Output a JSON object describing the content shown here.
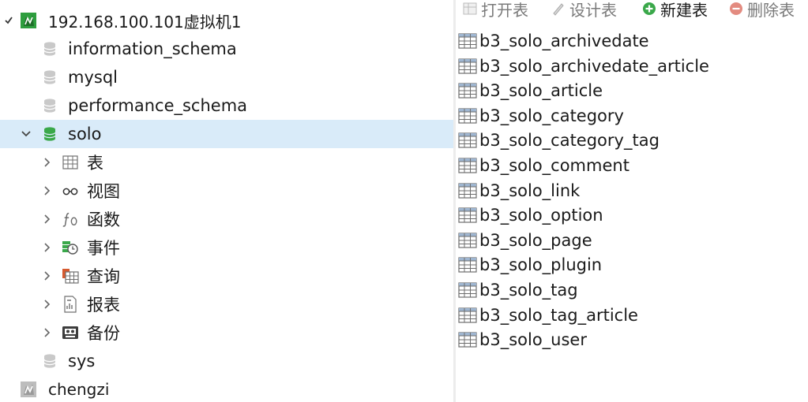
{
  "tree": {
    "connection": {
      "label": "192.168.100.101虚拟机1",
      "expanded": true,
      "icon": "connection-open-icon",
      "color": "#2e9e3e"
    },
    "databases": [
      {
        "label": "information_schema",
        "icon": "database-icon"
      },
      {
        "label": "mysql",
        "icon": "database-icon"
      },
      {
        "label": "performance_schema",
        "icon": "database-icon"
      },
      {
        "label": "solo",
        "icon": "database-open-icon",
        "expanded": true,
        "selected": true,
        "color": "#3aa84a"
      }
    ],
    "solo_children": [
      {
        "label": "表",
        "icon": "table-icon"
      },
      {
        "label": "视图",
        "icon": "view-icon"
      },
      {
        "label": "函数",
        "icon": "function-icon"
      },
      {
        "label": "事件",
        "icon": "event-icon"
      },
      {
        "label": "查询",
        "icon": "query-icon"
      },
      {
        "label": "报表",
        "icon": "report-icon"
      },
      {
        "label": "备份",
        "icon": "backup-icon"
      }
    ],
    "after_solo": [
      {
        "label": "sys",
        "icon": "database-icon"
      }
    ],
    "connection2": {
      "label": "chengzi",
      "icon": "connection-closed-icon"
    },
    "selection_color": "#d9ebf9"
  },
  "toolbar": {
    "open_label": "打开表",
    "design_label": "设计表",
    "new_label": "新建表",
    "delete_label": "删除表"
  },
  "tables": [
    "b3_solo_archivedate",
    "b3_solo_archivedate_article",
    "b3_solo_article",
    "b3_solo_category",
    "b3_solo_category_tag",
    "b3_solo_comment",
    "b3_solo_link",
    "b3_solo_option",
    "b3_solo_page",
    "b3_solo_plugin",
    "b3_solo_tag",
    "b3_solo_tag_article",
    "b3_solo_user"
  ]
}
